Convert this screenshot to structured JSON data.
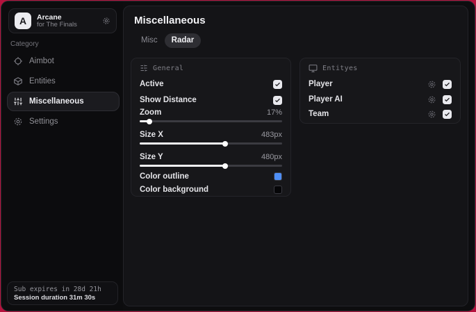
{
  "colors": {
    "backdrop": "#b5123d",
    "accent_blue": "#4e8ef5",
    "swatch_black": "#060608"
  },
  "sidebar": {
    "logo": {
      "initial": "A",
      "title": "Arcane",
      "subtitle": "for The Finals"
    },
    "category_label": "Category",
    "items": [
      {
        "label": "Aimbot",
        "icon": "crosshair-icon",
        "active": false
      },
      {
        "label": "Entities",
        "icon": "cube-icon",
        "active": false
      },
      {
        "label": "Miscellaneous",
        "icon": "sliders-icon",
        "active": true
      },
      {
        "label": "Settings",
        "icon": "gear-icon",
        "active": false
      }
    ],
    "footer": {
      "line1": "Sub expires in 28d 21h",
      "line2": "Session duration 31m 30s"
    }
  },
  "main": {
    "title": "Miscellaneous",
    "tabs": [
      {
        "label": "Misc",
        "active": false
      },
      {
        "label": "Radar",
        "active": true
      }
    ],
    "general": {
      "title": "General",
      "active_label": "Active",
      "active_checked": true,
      "show_distance_label": "Show Distance",
      "show_distance_checked": true,
      "zoom": {
        "label": "Zoom",
        "value": "17%",
        "percent": 7
      },
      "size_x": {
        "label": "Size X",
        "value": "483px",
        "percent": 60
      },
      "size_y": {
        "label": "Size Y",
        "value": "480px",
        "percent": 60
      },
      "color_outline": {
        "label": "Color outline",
        "color": "#4e8ef5"
      },
      "color_background": {
        "label": "Color background",
        "color": "#060608"
      }
    },
    "entities": {
      "title": "Entityes",
      "rows": [
        {
          "label": "Player",
          "checked": true
        },
        {
          "label": "Player AI",
          "checked": true
        },
        {
          "label": "Team",
          "checked": true
        }
      ]
    }
  }
}
